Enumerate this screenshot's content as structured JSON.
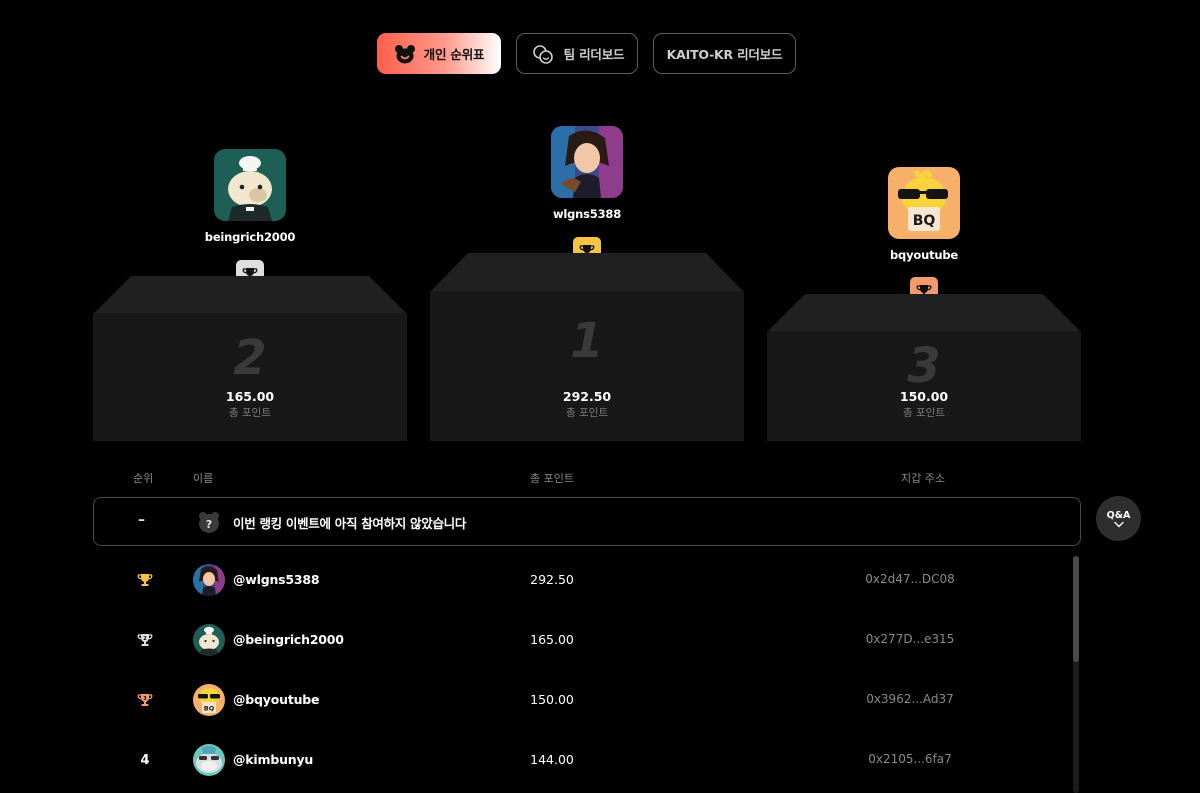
{
  "tabs": {
    "individual": "개인 순위표",
    "team": "팀 리더보드",
    "kaito": "KAITO-KR 리더보드"
  },
  "podium": {
    "first": {
      "rank": "1",
      "username": "wlgns5388",
      "points": "292.50",
      "points_label": "총 포인트"
    },
    "second": {
      "rank": "2",
      "username": "beingrich2000",
      "points": "165.00",
      "points_label": "총 포인트"
    },
    "third": {
      "rank": "3",
      "username": "bqyoutube",
      "points": "150.00",
      "points_label": "총 포인트"
    }
  },
  "table": {
    "headers": {
      "rank": "순위",
      "name": "이름",
      "points": "총 포인트",
      "wallet": "지갑 주소"
    },
    "notice": {
      "rank": "–",
      "text": "이번 랭킹 이벤트에 아직 참여하지 않았습니다"
    },
    "rows": [
      {
        "rank": "",
        "handle": "@wlgns5388",
        "points": "292.50",
        "wallet": "0x2d47...DC08",
        "trophy": "gold-trophy-icon"
      },
      {
        "rank": "",
        "handle": "@beingrich2000",
        "points": "165.00",
        "wallet": "0x277D...e315",
        "trophy": "silver-trophy-icon"
      },
      {
        "rank": "",
        "handle": "@bqyoutube",
        "points": "150.00",
        "wallet": "0x3962...Ad37",
        "trophy": "bronze-trophy-icon"
      },
      {
        "rank": "4",
        "handle": "@kimbunyu",
        "points": "144.00",
        "wallet": "0x2105...6fa7"
      }
    ]
  },
  "qa_button": {
    "label": "Q&A"
  },
  "colors": {
    "gold": "#f4c542",
    "silver": "#dedede",
    "bronze": "#f49b6c",
    "accent": "#ff5f4c",
    "podium_front": "#181818",
    "podium_top": "#202020"
  }
}
